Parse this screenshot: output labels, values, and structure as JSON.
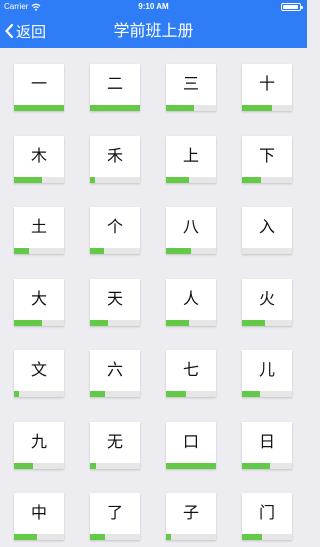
{
  "status_bar": {
    "carrier": "Carrier",
    "time": "9:10 AM"
  },
  "nav": {
    "back_label": "返回",
    "title": "学前班上册"
  },
  "colors": {
    "nav": "#2e7df6",
    "progress": "#65c948",
    "track": "#e6e6e6",
    "background": "#ececf1"
  },
  "characters": [
    {
      "char": "一",
      "progress": 1.0
    },
    {
      "char": "二",
      "progress": 1.0
    },
    {
      "char": "三",
      "progress": 0.55
    },
    {
      "char": "十",
      "progress": 0.6
    },
    {
      "char": "木",
      "progress": 0.55
    },
    {
      "char": "禾",
      "progress": 0.1
    },
    {
      "char": "上",
      "progress": 0.45
    },
    {
      "char": "下",
      "progress": 0.38
    },
    {
      "char": "土",
      "progress": 0.3
    },
    {
      "char": "个",
      "progress": 0.28
    },
    {
      "char": "八",
      "progress": 0.5
    },
    {
      "char": "入",
      "progress": 0.0
    },
    {
      "char": "大",
      "progress": 0.55
    },
    {
      "char": "天",
      "progress": 0.35
    },
    {
      "char": "人",
      "progress": 0.45
    },
    {
      "char": "火",
      "progress": 0.45
    },
    {
      "char": "文",
      "progress": 0.1
    },
    {
      "char": "六",
      "progress": 0.3
    },
    {
      "char": "七",
      "progress": 0.4
    },
    {
      "char": "儿",
      "progress": 0.35
    },
    {
      "char": "九",
      "progress": 0.38
    },
    {
      "char": "无",
      "progress": 0.12
    },
    {
      "char": "口",
      "progress": 1.0
    },
    {
      "char": "日",
      "progress": 0.55
    },
    {
      "char": "中",
      "progress": 0.45
    },
    {
      "char": "了",
      "progress": 0.3
    },
    {
      "char": "子",
      "progress": 0.1
    },
    {
      "char": "门",
      "progress": 0.4
    }
  ]
}
